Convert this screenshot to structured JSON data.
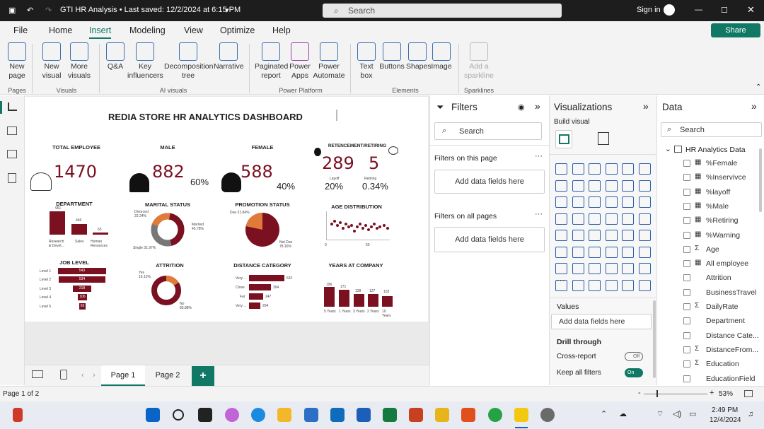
{
  "titlebar": {
    "title": "GTI HR Analysis • Last saved: 12/2/2024 at 6:15 PM",
    "search": "Search",
    "signin": "Sign in"
  },
  "menu": [
    "File",
    "Home",
    "Insert",
    "Modeling",
    "View",
    "Optimize",
    "Help"
  ],
  "share": "Share",
  "ribbon": {
    "buttons": [
      "New page",
      "New visual",
      "More visuals",
      "Q&A",
      "Key influencers",
      "Decomposition tree",
      "Narrative",
      "Paginated report",
      "Power Apps",
      "Power Automate",
      "Text box",
      "Buttons",
      "Shapes",
      "Image",
      "Add a sparkline"
    ],
    "groups": [
      "Pages",
      "Visuals",
      "AI visuals",
      "Power Platform",
      "Elements",
      "Sparklines"
    ]
  },
  "report": {
    "title": "REDIA STORE HR ANALYTICS DASHBOARD",
    "total_employee": {
      "label": "TOTAL EMPLOYEE",
      "value": "1470"
    },
    "male": {
      "label": "MALE",
      "value": "882",
      "pct": "60%"
    },
    "female": {
      "label": "FEMALE",
      "value": "588",
      "pct": "40%"
    },
    "retirement": {
      "label": "RETENCEMENT/RETIRING",
      "layoff": "289",
      "retiring": "5",
      "layoff_label": "Layoff",
      "retiring_label": "Retiring",
      "layoff_pct": "20%",
      "retiring_pct": "0.34%"
    },
    "department": {
      "label": "DEPARTMENT",
      "values": [
        "961",
        "446",
        "63"
      ],
      "cats": [
        "Research & Devel...",
        "Sales",
        "Human Resources"
      ]
    },
    "marital": {
      "label": "MARITAL STATUS",
      "divorced": "Divorced 22.24%",
      "married": "Married 45.78%",
      "single": "Single 31.97%"
    },
    "promotion": {
      "label": "PROMOTION STATUS",
      "due": "Due 21.84%",
      "notdue": "Not Due 78.16%"
    },
    "age": {
      "label": "AGE DISTRIBUTION",
      "x0": "0",
      "x1": "50"
    },
    "job": {
      "label": "JOB LEVEL",
      "levels": [
        "Level 1",
        "Level 2",
        "Level 3",
        "Level 4",
        "Level 5"
      ],
      "values": [
        "543",
        "534",
        "218",
        "106",
        "69"
      ]
    },
    "attrition": {
      "label": "ATTRITION",
      "yes": "Yes 16.12%",
      "no": "No 83.88%"
    },
    "distance": {
      "label": "DISTANCE CATEGORY",
      "cats": [
        "Very ...",
        "Close",
        "Far",
        "Very ..."
      ],
      "values": [
        "632",
        "394",
        "247",
        "204"
      ]
    },
    "years": {
      "label": "YEARS AT COMPANY",
      "values": [
        "196",
        "171",
        "128",
        "127",
        "103"
      ],
      "cats": [
        "5 Years",
        "1 Years",
        "3 Years",
        "2 Years",
        "10 Years"
      ]
    }
  },
  "tabs": [
    "Page 1",
    "Page 2"
  ],
  "filters": {
    "title": "Filters",
    "search": "Search",
    "on_page": "Filters on this page",
    "on_all": "Filters on all pages",
    "add": "Add data fields here"
  },
  "viz": {
    "title": "Visualizations",
    "build": "Build visual",
    "values": "Values",
    "add": "Add data fields here",
    "drill": "Drill through",
    "cross": "Cross-report",
    "cross_state": "Off",
    "keep": "Keep all filters",
    "keep_state": "On"
  },
  "data": {
    "title": "Data",
    "search": "Search",
    "table": "HR Analytics Data",
    "fields": [
      {
        "s": "calc",
        "n": "%Female"
      },
      {
        "s": "calc",
        "n": "%Inservivce"
      },
      {
        "s": "calc",
        "n": "%layoff"
      },
      {
        "s": "calc",
        "n": "%Male"
      },
      {
        "s": "calc",
        "n": "%Retiring"
      },
      {
        "s": "calc",
        "n": "%Warning"
      },
      {
        "s": "Σ",
        "n": "Age"
      },
      {
        "s": "calc",
        "n": "All employee"
      },
      {
        "s": "",
        "n": "Attrition"
      },
      {
        "s": "",
        "n": "BusinessTravel"
      },
      {
        "s": "Σ",
        "n": "DailyRate"
      },
      {
        "s": "",
        "n": "Department"
      },
      {
        "s": "",
        "n": "Distance Cate..."
      },
      {
        "s": "Σ",
        "n": "DistanceFrom..."
      },
      {
        "s": "Σ",
        "n": "Education"
      },
      {
        "s": "",
        "n": "EducationField"
      }
    ]
  },
  "status": {
    "page": "Page 1 of 2",
    "zoom": "53%"
  },
  "taskbar": {
    "time": "2:49 PM",
    "date": "12/4/2024"
  }
}
